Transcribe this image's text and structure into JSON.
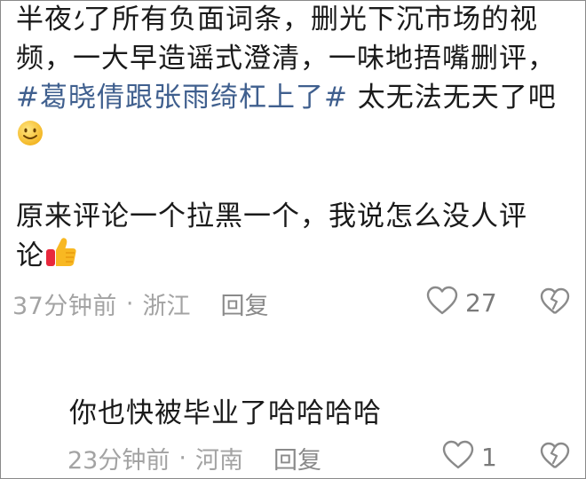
{
  "comment": {
    "line1": "半夜",
    "line1_partial": "火",
    "line1_rest": "了所有负面词条，删光下沉市场的视",
    "line2": "频，一大早造谣式澄清，一味地捂嘴删评，",
    "hashtag": "#葛晓倩跟张雨绮杠上了#",
    "line3_rest": " 太无法无天了吧",
    "emoji1": "smile-emoji",
    "para2_line1": "原来评论一个拉黑一个，我说怎么没人评",
    "para2_line2": "论",
    "emoji2": "thumbs-up-emoji",
    "time": "37分钟前",
    "dot": "·",
    "location": "浙江",
    "reply_label": "回复",
    "like_count": "27"
  },
  "reply": {
    "text": "你也快被毕业了哈哈哈哈",
    "time": "23分钟前",
    "dot": "·",
    "location": "河南",
    "reply_label": "回复",
    "like_count": "1"
  },
  "colors": {
    "hashtag": "#3f5f8e",
    "meta": "#a3a3a3"
  }
}
